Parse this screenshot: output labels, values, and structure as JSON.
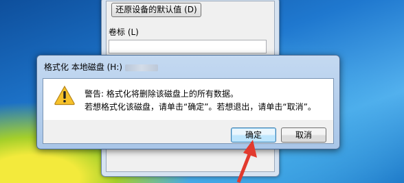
{
  "background_dialog": {
    "restore_defaults_label": "还原设备的默认值 (D)",
    "volume_label": "卷标 (L)",
    "volume_value": ""
  },
  "message_box": {
    "title": "格式化 本地磁盘 (H:)",
    "line1": "警告: 格式化将删除该磁盘上的所有数据。",
    "line2": "若想格式化该磁盘，请单击“确定”。若想退出，请单击“取消”。",
    "ok_label": "确定",
    "cancel_label": "取消",
    "icon": "warning-icon"
  },
  "colors": {
    "arrow": "#e23a2e",
    "warning_fill": "#f6c12a"
  }
}
